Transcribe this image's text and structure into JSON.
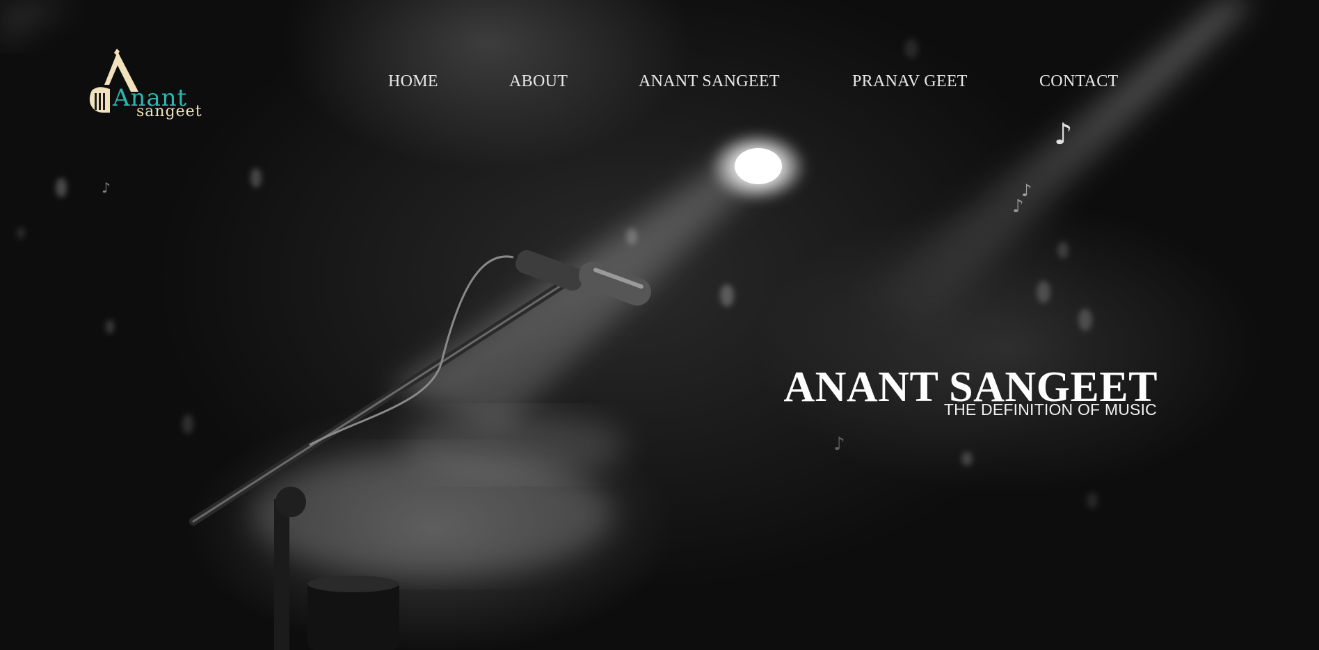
{
  "logo": {
    "word1": "Anant",
    "word2": "sangeet",
    "colors": {
      "accent": "#2bb7b3",
      "cream": "#f1e2bd"
    }
  },
  "nav": {
    "items": [
      {
        "label": "HOME"
      },
      {
        "label": "ABOUT"
      },
      {
        "label": "ANANT SANGEET"
      },
      {
        "label": "PRANAV GEET"
      },
      {
        "label": "CONTACT"
      }
    ]
  },
  "hero": {
    "title": "ANANT SANGEET",
    "subtitle": "THE DEFINITION OF MUSIC",
    "background": "microphone-on-stage-black-and-white"
  },
  "decor": {
    "note_glyph": "♪",
    "note_icon": "music-note-icon"
  }
}
